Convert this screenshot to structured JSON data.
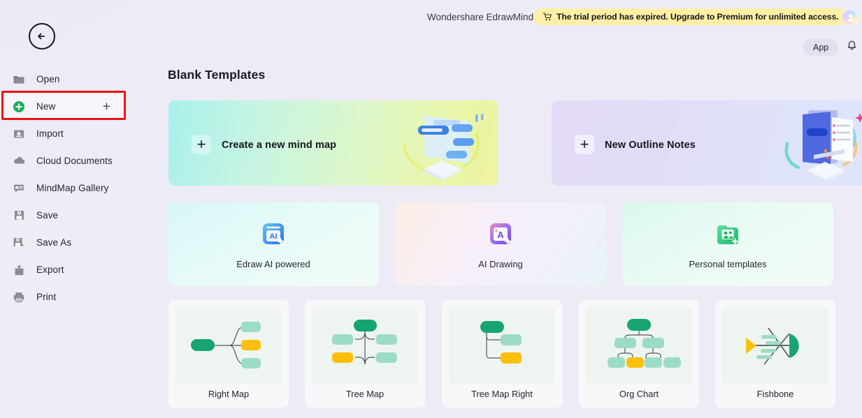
{
  "window": {
    "app_title": "Wondershare EdrawMind",
    "background_color": "#edecf6"
  },
  "topbar": {
    "trial_banner": {
      "text": "The trial period has expired. Upgrade to Premium for unlimited access.",
      "icon": "shopping-cart-icon",
      "background_color": "#fdf0a6",
      "text_color": "#16161c"
    },
    "avatar_icon": "user-avatar-icon",
    "app_button_label": "App",
    "notification_icon": "bell-icon"
  },
  "sidebar": {
    "back_icon": "back-arrow-icon",
    "items": [
      {
        "label": "Open",
        "icon": "folder-icon",
        "active": false,
        "trailing": ""
      },
      {
        "label": "New",
        "icon": "plus-circle-icon",
        "active": true,
        "trailing": "+"
      },
      {
        "label": "Import",
        "icon": "import-icon",
        "active": false,
        "trailing": ""
      },
      {
        "label": "Cloud Documents",
        "icon": "cloud-icon",
        "active": false,
        "trailing": ""
      },
      {
        "label": "MindMap Gallery",
        "icon": "gallery-chat-icon",
        "active": false,
        "trailing": ""
      },
      {
        "label": "Save",
        "icon": "save-disk-icon",
        "active": false,
        "trailing": ""
      },
      {
        "label": "Save As",
        "icon": "save-as-disk-icon",
        "active": false,
        "trailing": ""
      },
      {
        "label": "Export",
        "icon": "export-upload-icon",
        "active": false,
        "trailing": ""
      },
      {
        "label": "Print",
        "icon": "printer-icon",
        "active": false,
        "trailing": ""
      }
    ],
    "highlight_color": "#ee1111",
    "highlighted_item": "New"
  },
  "main": {
    "section_title": "Blank Templates",
    "blank_templates": [
      {
        "label": "Create a new mind map",
        "icon": "plus-icon",
        "art": "mindmap-illustration",
        "highlighted": true
      },
      {
        "label": "New Outline Notes",
        "icon": "plus-icon",
        "art": "outline-notes-illustration",
        "highlighted": false
      }
    ],
    "feature_cards": [
      {
        "label": "Edraw AI powered",
        "icon": "ai-document-icon"
      },
      {
        "label": "AI Drawing",
        "icon": "ai-drawing-icon"
      },
      {
        "label": "Personal templates",
        "icon": "personal-folder-icon"
      }
    ],
    "diagram_templates": [
      {
        "label": "Right Map",
        "thumb": "right-map-thumb"
      },
      {
        "label": "Tree Map",
        "thumb": "tree-map-thumb"
      },
      {
        "label": "Tree Map Right",
        "thumb": "tree-map-right-thumb"
      },
      {
        "label": "Org Chart",
        "thumb": "org-chart-thumb"
      },
      {
        "label": "Fishbone",
        "thumb": "fishbone-thumb"
      }
    ],
    "accent_colors": {
      "node_primary": "#16a571",
      "node_secondary": "#9ddcc4",
      "node_highlight": "#fcc00c",
      "connector": "#55555f"
    }
  }
}
